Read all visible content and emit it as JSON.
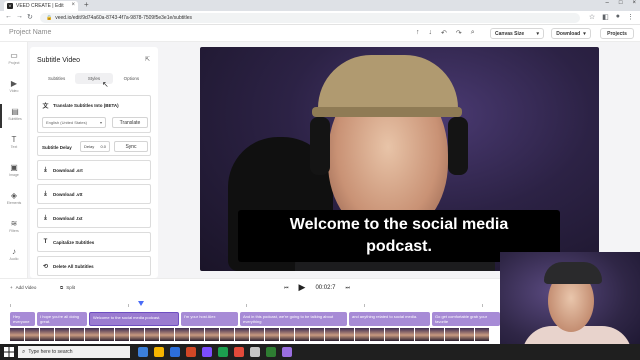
{
  "browser": {
    "tab_title": "VEED CREATE | Edit",
    "tab_favicon": "V",
    "url": "veed.io/edit/9d74a60a-8743-4f7a-9878-7509f5e3e1e/subtitles"
  },
  "header": {
    "project_name": "Project Name",
    "canvas_size_label": "Canvas Size",
    "download_label": "Download",
    "projects_label": "Projects"
  },
  "rail": {
    "items": [
      {
        "icon": "project-icon",
        "glyph": "▭",
        "label": "Project"
      },
      {
        "icon": "video-icon",
        "glyph": "▶",
        "label": "Video"
      },
      {
        "icon": "subtitles-icon",
        "glyph": "▤",
        "label": "Subtitles"
      },
      {
        "icon": "text-icon",
        "glyph": "T",
        "label": "Text"
      },
      {
        "icon": "image-icon",
        "glyph": "▣",
        "label": "Image"
      },
      {
        "icon": "elements-icon",
        "glyph": "◈",
        "label": "Elements"
      },
      {
        "icon": "filters-icon",
        "glyph": "≋",
        "label": "Filters"
      },
      {
        "icon": "audio-icon",
        "glyph": "♪",
        "label": "Audio"
      }
    ]
  },
  "panel": {
    "title": "Subtitle Video",
    "tabs": [
      "Subtitles",
      "Styles",
      "Options"
    ],
    "translate": {
      "label": "Translate Subtitles Into (BETA)",
      "language": "English (United States)",
      "button": "Translate"
    },
    "delay": {
      "label": "Subtitle Delay",
      "field_label": "Delay",
      "value": "0.0",
      "sync_button": "Sync"
    },
    "actions": [
      {
        "icon": "download-icon",
        "glyph": "⤓",
        "label": "Download .srt"
      },
      {
        "icon": "download-icon",
        "glyph": "⤓",
        "label": "Download .vtt"
      },
      {
        "icon": "download-icon",
        "glyph": "⤓",
        "label": "Download .txt"
      },
      {
        "icon": "capitalize-icon",
        "glyph": "T",
        "label": "Capitalize Subtitles"
      },
      {
        "icon": "delete-icon",
        "glyph": "⟲",
        "label": "Delete All Subtitles"
      }
    ]
  },
  "video": {
    "caption_line1": "Welcome to the social media",
    "caption_line2": "podcast."
  },
  "timeline": {
    "add_video_label": "Add Video",
    "split_label": "Split",
    "current_time": "00:02:7",
    "clips": [
      {
        "text": "Hey everyone"
      },
      {
        "text": "I hope you're all doing great."
      },
      {
        "text": "Welcome to the social media podcast."
      },
      {
        "text": "I'm your host Alex"
      },
      {
        "text": "And in this podcast, we're going to be talking about everything"
      },
      {
        "text": "and anything related to social media."
      },
      {
        "text": "Go get comfortable grab your favorite"
      }
    ]
  },
  "taskbar": {
    "search_placeholder": "Type here to search",
    "icon_colors": [
      "#3c7fd9",
      "#f5b400",
      "#2d6fdb",
      "#d24726",
      "#7c4dff",
      "#1c9f50",
      "#e34a3a",
      "#c6c6c6",
      "#2e7d32",
      "#9a6ee0"
    ]
  },
  "colors": {
    "accent": "#4a6cf7",
    "clip": "#a78bd6"
  }
}
